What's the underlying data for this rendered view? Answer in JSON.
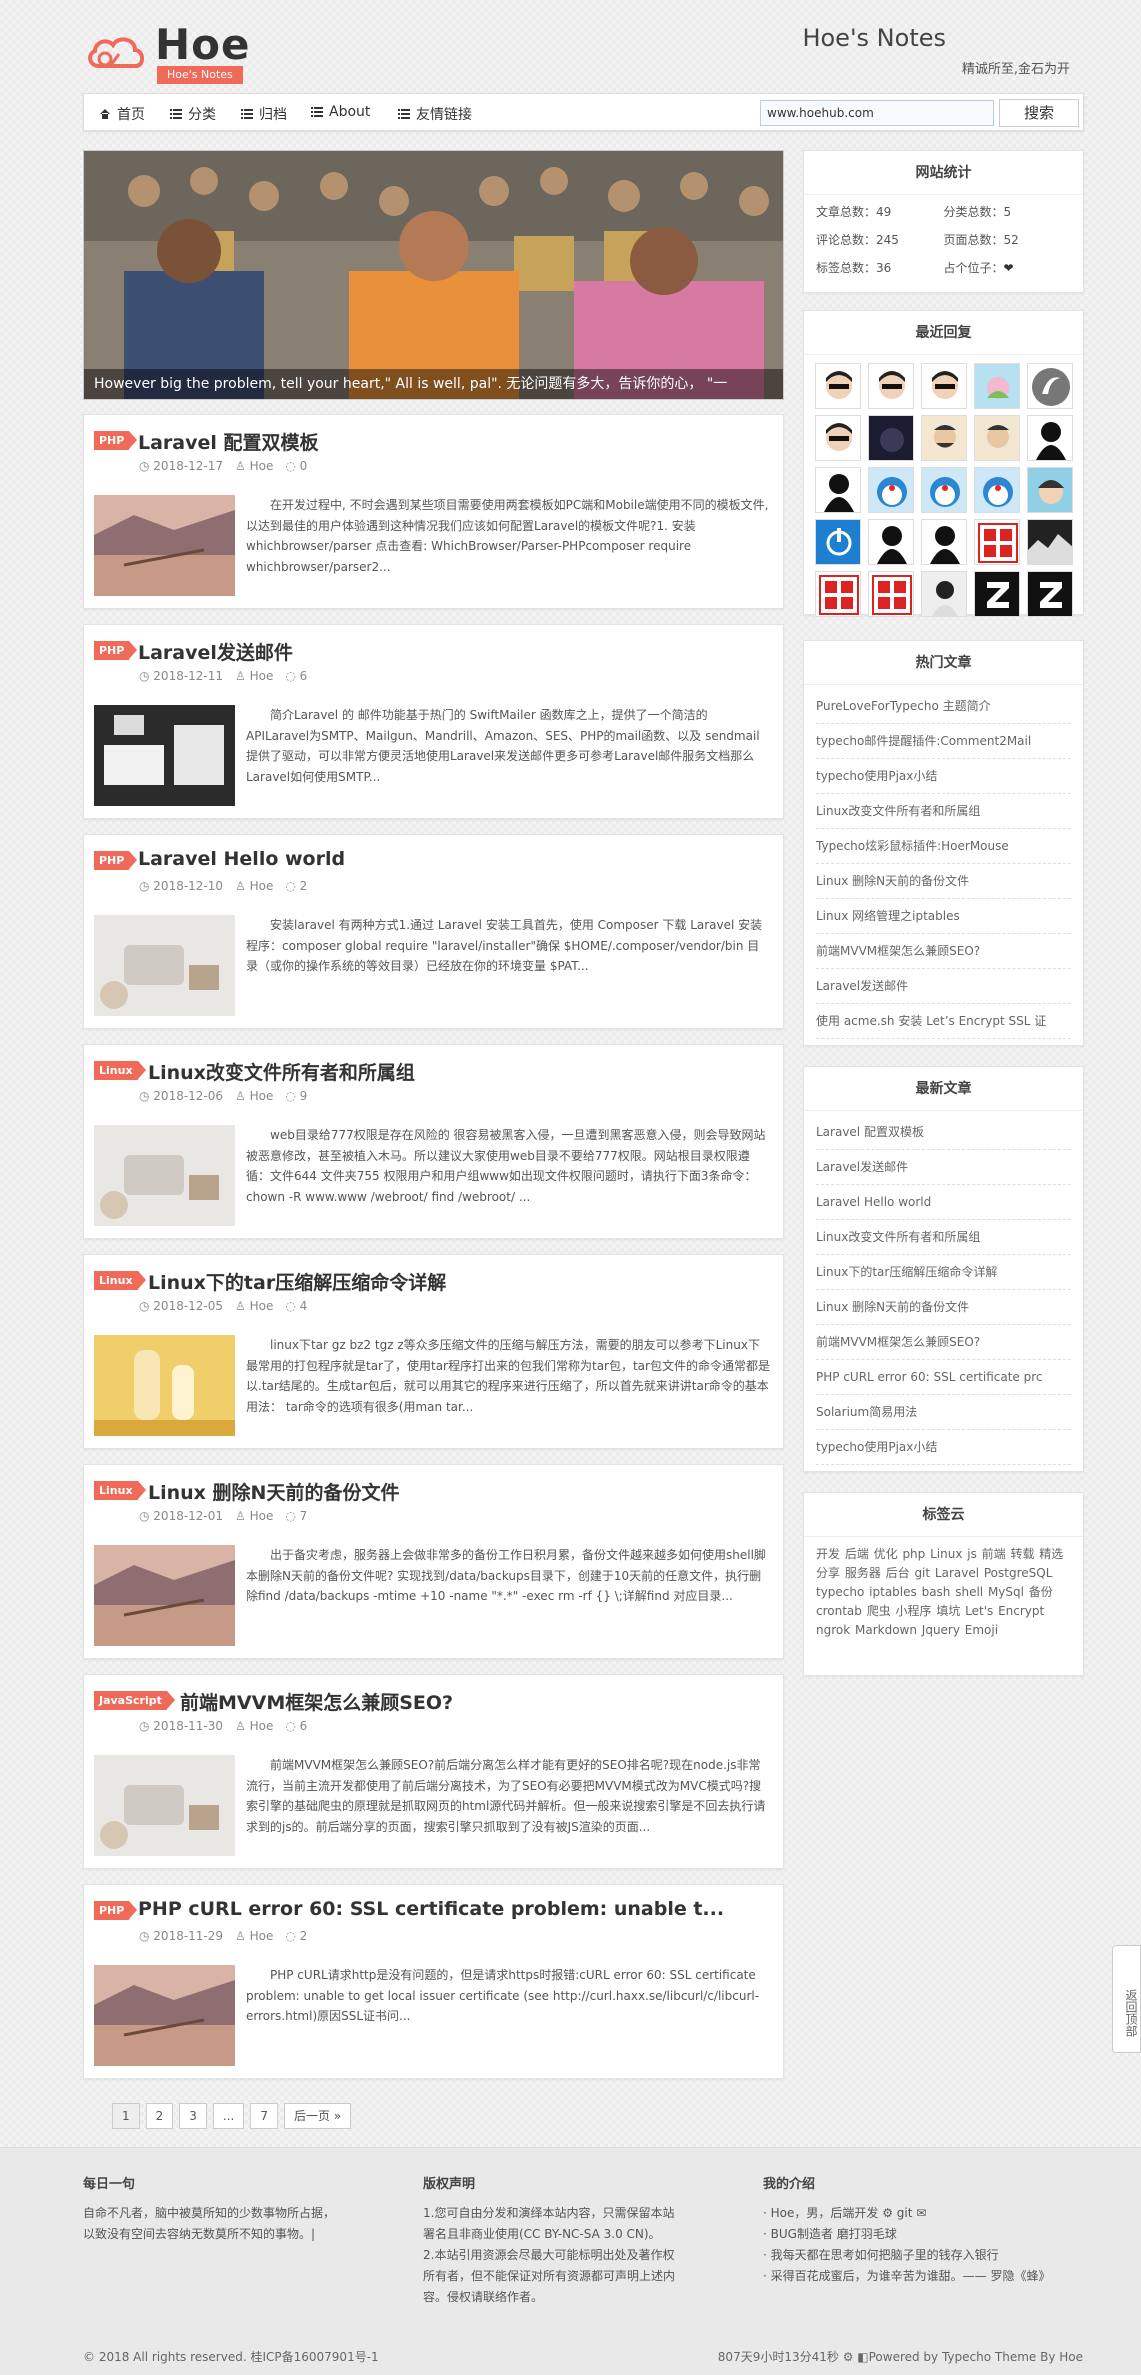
{
  "header": {
    "logo_text": "Hoe",
    "logo_tag": "Hoe's Notes",
    "site_title": "Hoe's Notes",
    "site_subtitle": "精诚所至,金石为开"
  },
  "nav": {
    "items": [
      "首页",
      "分类",
      "归档",
      "About",
      "友情链接"
    ],
    "search_value": "www.hoehub.com",
    "search_button": "搜索"
  },
  "hero": {
    "caption": "However big the problem, tell your heart,\" All is well, pal\". 无论问题有多大，告诉你的心， \"一"
  },
  "posts": [
    {
      "tag": "PHP",
      "title": "Laravel 配置双模板",
      "date": "2018-12-17",
      "author": "Hoe",
      "comments": "0",
      "excerpt": "在开发过程中, 不时会遇到某些项目需要使用两套模板如PC端和Mobile端使用不同的模板文件, 以达到最佳的用户体验遇到这种情况我们应该如何配置Laravel的模板文件呢?1. 安装whichbrowser/parser 点击查看: WhichBrowser/Parser-PHPcomposer require whichbrowser/parser2..."
    },
    {
      "tag": "PHP",
      "title": "Laravel发送邮件",
      "date": "2018-12-11",
      "author": "Hoe",
      "comments": "6",
      "excerpt": "简介Laravel 的 邮件功能基于热门的 SwiftMailer 函数库之上，提供了一个简洁的 APILaravel为SMTP、Mailgun、Mandrill、Amazon、SES、PHP的mail函数、以及 sendmail提供了驱动，可以非常方便灵活地使用Laravel来发送邮件更多可参考Laravel邮件服务文档那么Laravel如何使用SMTP..."
    },
    {
      "tag": "PHP",
      "title": "Laravel Hello world",
      "date": "2018-12-10",
      "author": "Hoe",
      "comments": "2",
      "excerpt": "安装laravel 有两种方式1.通过 Laravel 安装工具首先，使用 Composer 下载 Laravel 安装程序：composer global require \"laravel/installer\"确保 $HOME/.composer/vendor/bin 目录（或你的操作系统的等效目录）已经放在你的环境变量 $PAT..."
    },
    {
      "tag": "Linux",
      "title": "Linux改变文件所有者和所属组",
      "date": "2018-12-06",
      "author": "Hoe",
      "comments": "9",
      "excerpt": "web目录给777权限是存在风险的 很容易被黑客入侵，一旦遭到黑客恶意入侵，则会导致网站被恶意修改，甚至被植入木马。所以建议大家使用web目录不要给777权限。网站根目录权限遵循：文件644 文件夹755 权限用户和用户组www如出现文件权限问题时，请执行下面3条命令：chown -R www.www /webroot/ find /webroot/ ..."
    },
    {
      "tag": "Linux",
      "title": "Linux下的tar压缩解压缩命令详解",
      "date": "2018-12-05",
      "author": "Hoe",
      "comments": "4",
      "excerpt": "linux下tar gz bz2 tgz z等众多压缩文件的压缩与解压方法，需要的朋友可以参考下Linux下最常用的打包程序就是tar了，使用tar程序打出来的包我们常称为tar包，tar包文件的命令通常都是以.tar结尾的。生成tar包后，就可以用其它的程序来进行压缩了，所以首先就来讲讲tar命令的基本用法： tar命令的选项有很多(用man tar..."
    },
    {
      "tag": "Linux",
      "title": "Linux 删除N天前的备份文件",
      "date": "2018-12-01",
      "author": "Hoe",
      "comments": "7",
      "excerpt": "出于备灾考虑，服务器上会做非常多的备份工作日积月累，备份文件越来越多如何使用shell脚本删除N天前的备份文件呢? 实现找到/data/backups目录下，创建于10天前的任意文件，执行删除find /data/backups -mtime +10 -name \"*.*\" -exec rm -rf {} \\;详解find 对应目录..."
    },
    {
      "tag": "JavaScript",
      "title": "前端MVVM框架怎么兼顾SEO?",
      "date": "2018-11-30",
      "author": "Hoe",
      "comments": "6",
      "excerpt": "前端MVVM框架怎么兼顾SEO?前后端分离怎么样才能有更好的SEO排名呢?现在node.js非常流行，当前主流开发都使用了前后端分离技术，为了SEO有必要把MVVM模式改为MVC模式吗?搜索引擎的基础爬虫的原理就是抓取网页的html源代码并解析。但一般来说搜索引擎是不回去执行请求到的js的。前后端分享的页面，搜索引擎只抓取到了没有被JS渲染的页面..."
    },
    {
      "tag": "PHP",
      "title": "PHP cURL error 60: SSL certificate problem: unable t...",
      "date": "2018-11-29",
      "author": "Hoe",
      "comments": "2",
      "excerpt": "PHP cURL请求http是没有问题的，但是请求https时报错:cURL error 60: SSL certificate problem: unable to get local issuer certificate (see http://curl.haxx.se/libcurl/c/libcurl-errors.html)原因SSL证书问..."
    }
  ],
  "pager": [
    "1",
    "2",
    "3",
    "...",
    "7",
    "后一页 »"
  ],
  "sidebar": {
    "stats": {
      "title": "网站统计",
      "items": [
        "文章总数：49",
        "分类总数：5",
        "评论总数：245",
        "页面总数：52",
        "标签总数：36",
        "占个位子："
      ]
    },
    "recent_replies": {
      "title": "最近回复"
    },
    "hot": {
      "title": "热门文章",
      "items": [
        "PureLoveForTypecho 主题简介",
        "typecho邮件提醒插件:Comment2Mail",
        "typecho使用Pjax小结",
        "Linux改变文件所有者和所属组",
        "Typecho炫彩鼠标插件:HoerMouse",
        "Linux 删除N天前的备份文件",
        "Linux 网络管理之iptables",
        "前端MVVM框架怎么兼顾SEO?",
        "Laravel发送邮件",
        "使用 acme.sh 安装 Let’s Encrypt SSL 证"
      ]
    },
    "latest": {
      "title": "最新文章",
      "items": [
        "Laravel 配置双模板",
        "Laravel发送邮件",
        "Laravel Hello world",
        "Linux改变文件所有者和所属组",
        "Linux下的tar压缩解压缩命令详解",
        "Linux 删除N天前的备份文件",
        "前端MVVM框架怎么兼顾SEO?",
        "PHP cURL error 60: SSL certificate prc",
        "Solarium简易用法",
        "typecho使用Pjax小结"
      ]
    },
    "tags": {
      "title": "标签云",
      "text": "开发 后端 优化 php Linux js 前端 转载 精选 分享 服务器 后台 git Laravel PostgreSQL typecho iptables bash shell MySql 备份 crontab 爬虫 小程序 填坑 Let's Encrypt ngrok Markdown Jquery Emoji"
    }
  },
  "footer": {
    "col1": {
      "title": "每日一句",
      "lines": [
        "自命不凡者，脑中被莫所知的少数事物所占据，",
        "以致没有空间去容纳无数莫所不知的事物。|"
      ]
    },
    "col2": {
      "title": "版权声明",
      "lines": [
        "1.您可自由分发和演绎本站内容，只需保留本站",
        "署名且非商业使用(CC BY-NC-SA 3.0 CN)。",
        "2.本站引用资源会尽最大可能标明出处及著作权",
        "所有者，但不能保证对所有资源都可声明上述内",
        "容。侵权请联络作者。"
      ]
    },
    "col3": {
      "title": "我的介绍",
      "lines": [
        "· Hoe，男，后端开发 ⚙ git ✉",
        "· BUG制造者 磨打羽毛球",
        "· 我每天都在思考如何把脑子里的钱存入银行",
        "· 采得百花成蜜后，为谁辛苦为谁甜。—— 罗隐《蜂》"
      ]
    },
    "copyright": "© 2018 All rights reserved. 桂ICP备16007901号-1",
    "runtime": "807天9小时13分41秒 ⚙ ◧Powered by Typecho Theme By Hoe"
  },
  "side_button": "返回顶部",
  "colors": {
    "accent": "#f06a5a",
    "link": "#666666"
  }
}
